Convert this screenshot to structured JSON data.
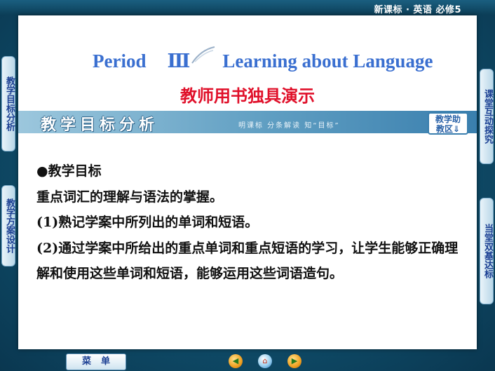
{
  "header": {
    "title": "新课标 · 英语    必修5"
  },
  "slide": {
    "period_label": "Period",
    "period_roman": "Ⅲ",
    "period_topic": "Learning about Language",
    "subtitle": "教师用书独具演示",
    "section": {
      "title": "教学目标分析",
      "subtext": "明课标  分条解读  知“目标”",
      "assist_button": {
        "line1": "教学助",
        "line2": "教区⇓"
      }
    },
    "content": {
      "heading": "●教学目标",
      "lines": [
        "重点词汇的理解与语法的掌握。",
        "(1)熟记学案中所列出的单词和短语。",
        "(2)通过学案中所给出的重点单词和重点短语的学习，让学生能够正确理解和使用这些单词和短语，能够运用这些词语造句。"
      ]
    }
  },
  "side_tabs": {
    "left": [
      "教学目标分析",
      "教学方案设计"
    ],
    "right": [
      "课堂互动探究",
      "当堂双基达标"
    ]
  },
  "footer": {
    "menu_label": "菜单",
    "nav": [
      "previous-icon",
      "home-icon",
      "next-icon"
    ]
  },
  "colors": {
    "title_blue": "#3a6fd0",
    "subtitle_red": "#e0102a",
    "band_blue": "#5f9ec2",
    "frame_teal": "#0f4d6a"
  }
}
